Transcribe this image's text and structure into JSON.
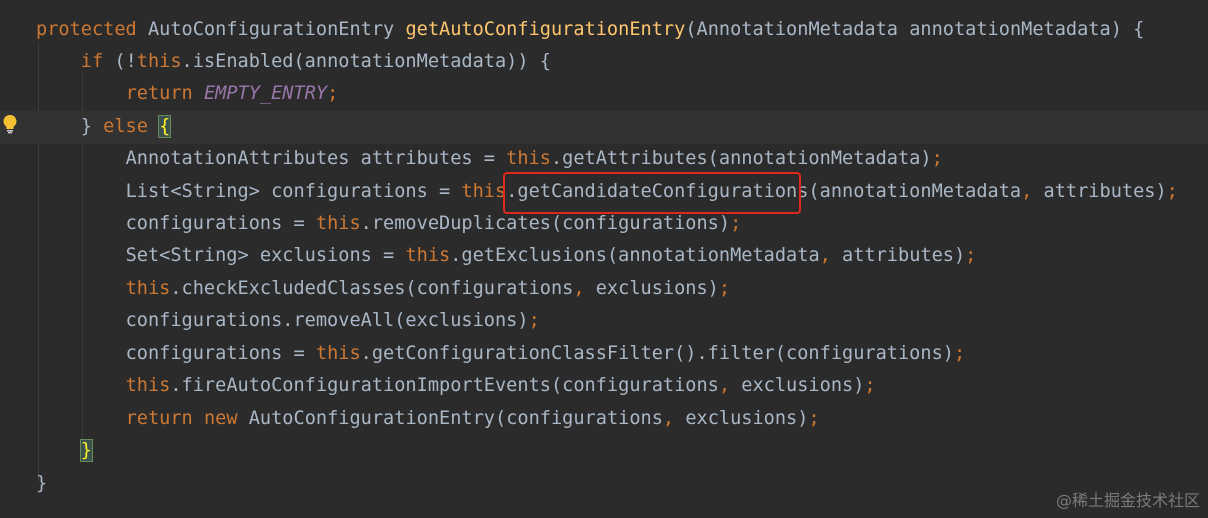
{
  "editor": {
    "lines": [
      {
        "tokens": [
          {
            "t": "protected ",
            "c": "kw"
          },
          {
            "t": "AutoConfigurationEntry ",
            "c": "plain"
          },
          {
            "t": "getAutoConfigurationEntry",
            "c": "fn"
          },
          {
            "t": "(AnnotationMetadata annotationMetadata) {",
            "c": "plain"
          }
        ]
      },
      {
        "tokens": [
          {
            "t": "    "
          },
          {
            "t": "if ",
            "c": "kw"
          },
          {
            "t": "(!",
            "c": "plain"
          },
          {
            "t": "this",
            "c": "kw"
          },
          {
            "t": ".isEnabled(annotationMetadata)) {",
            "c": "plain"
          }
        ]
      },
      {
        "tokens": [
          {
            "t": "        "
          },
          {
            "t": "return ",
            "c": "kw"
          },
          {
            "t": "EMPTY_ENTRY",
            "c": "const"
          },
          {
            "t": ";",
            "c": "punc"
          }
        ]
      },
      {
        "current": true,
        "tokens": [
          {
            "t": "    "
          },
          {
            "t": "} ",
            "c": "plain"
          },
          {
            "t": "else ",
            "c": "kw"
          },
          {
            "t": "{",
            "c": "brace-hl"
          }
        ]
      },
      {
        "tokens": [
          {
            "t": "        "
          },
          {
            "t": "AnnotationAttributes attributes = ",
            "c": "plain"
          },
          {
            "t": "this",
            "c": "kw"
          },
          {
            "t": ".getAttributes(annotationMetadata)",
            "c": "plain"
          },
          {
            "t": ";",
            "c": "punc"
          }
        ]
      },
      {
        "tokens": [
          {
            "t": "        "
          },
          {
            "t": "List<String> configurations = ",
            "c": "plain"
          },
          {
            "t": "this",
            "c": "kw"
          },
          {
            "t": ".getCandidateConfigurations(annotationMetadata",
            "c": "plain"
          },
          {
            "t": ", ",
            "c": "punc"
          },
          {
            "t": "attributes)",
            "c": "plain"
          },
          {
            "t": ";",
            "c": "punc"
          }
        ]
      },
      {
        "tokens": [
          {
            "t": "        "
          },
          {
            "t": "configurations = ",
            "c": "plain"
          },
          {
            "t": "this",
            "c": "kw"
          },
          {
            "t": ".removeDuplicates(configurations)",
            "c": "plain"
          },
          {
            "t": ";",
            "c": "punc"
          }
        ]
      },
      {
        "tokens": [
          {
            "t": "        "
          },
          {
            "t": "Set<String> exclusions = ",
            "c": "plain"
          },
          {
            "t": "this",
            "c": "kw"
          },
          {
            "t": ".getExclusions(annotationMetadata",
            "c": "plain"
          },
          {
            "t": ", ",
            "c": "punc"
          },
          {
            "t": "attributes)",
            "c": "plain"
          },
          {
            "t": ";",
            "c": "punc"
          }
        ]
      },
      {
        "tokens": [
          {
            "t": "        "
          },
          {
            "t": "this",
            "c": "kw"
          },
          {
            "t": ".checkExcludedClasses(configurations",
            "c": "plain"
          },
          {
            "t": ", ",
            "c": "punc"
          },
          {
            "t": "exclusions)",
            "c": "plain"
          },
          {
            "t": ";",
            "c": "punc"
          }
        ]
      },
      {
        "tokens": [
          {
            "t": "        "
          },
          {
            "t": "configurations.removeAll(exclusions)",
            "c": "plain"
          },
          {
            "t": ";",
            "c": "punc"
          }
        ]
      },
      {
        "tokens": [
          {
            "t": "        "
          },
          {
            "t": "configurations = ",
            "c": "plain"
          },
          {
            "t": "this",
            "c": "kw"
          },
          {
            "t": ".getConfigurationClassFilter().filter(configurations)",
            "c": "plain"
          },
          {
            "t": ";",
            "c": "punc"
          }
        ]
      },
      {
        "tokens": [
          {
            "t": "        "
          },
          {
            "t": "this",
            "c": "kw"
          },
          {
            "t": ".fireAutoConfigurationImportEvents(configurations",
            "c": "plain"
          },
          {
            "t": ", ",
            "c": "punc"
          },
          {
            "t": "exclusions)",
            "c": "plain"
          },
          {
            "t": ";",
            "c": "punc"
          }
        ]
      },
      {
        "tokens": [
          {
            "t": "        "
          },
          {
            "t": "return ",
            "c": "kw"
          },
          {
            "t": "new ",
            "c": "kw"
          },
          {
            "t": "AutoConfigurationEntry(configurations",
            "c": "plain"
          },
          {
            "t": ", ",
            "c": "punc"
          },
          {
            "t": "exclusions)",
            "c": "plain"
          },
          {
            "t": ";",
            "c": "punc"
          }
        ]
      },
      {
        "tokens": [
          {
            "t": "    "
          },
          {
            "t": "}",
            "c": "brace-hl"
          }
        ]
      },
      {
        "tokens": [
          {
            "t": "}",
            "c": "plain"
          }
        ]
      }
    ],
    "colors": {
      "background": "#2b2b2b",
      "keyword": "#cc7832",
      "method": "#ffc66d",
      "constant": "#9876aa",
      "text": "#a9b7c6",
      "annotation_box": "#e0261d"
    }
  },
  "gutter": {
    "icon": "lightbulb-icon"
  },
  "annotation": {
    "highlighted_text": "getCandidateConfigurations"
  },
  "watermark": "@稀土掘金技术社区"
}
